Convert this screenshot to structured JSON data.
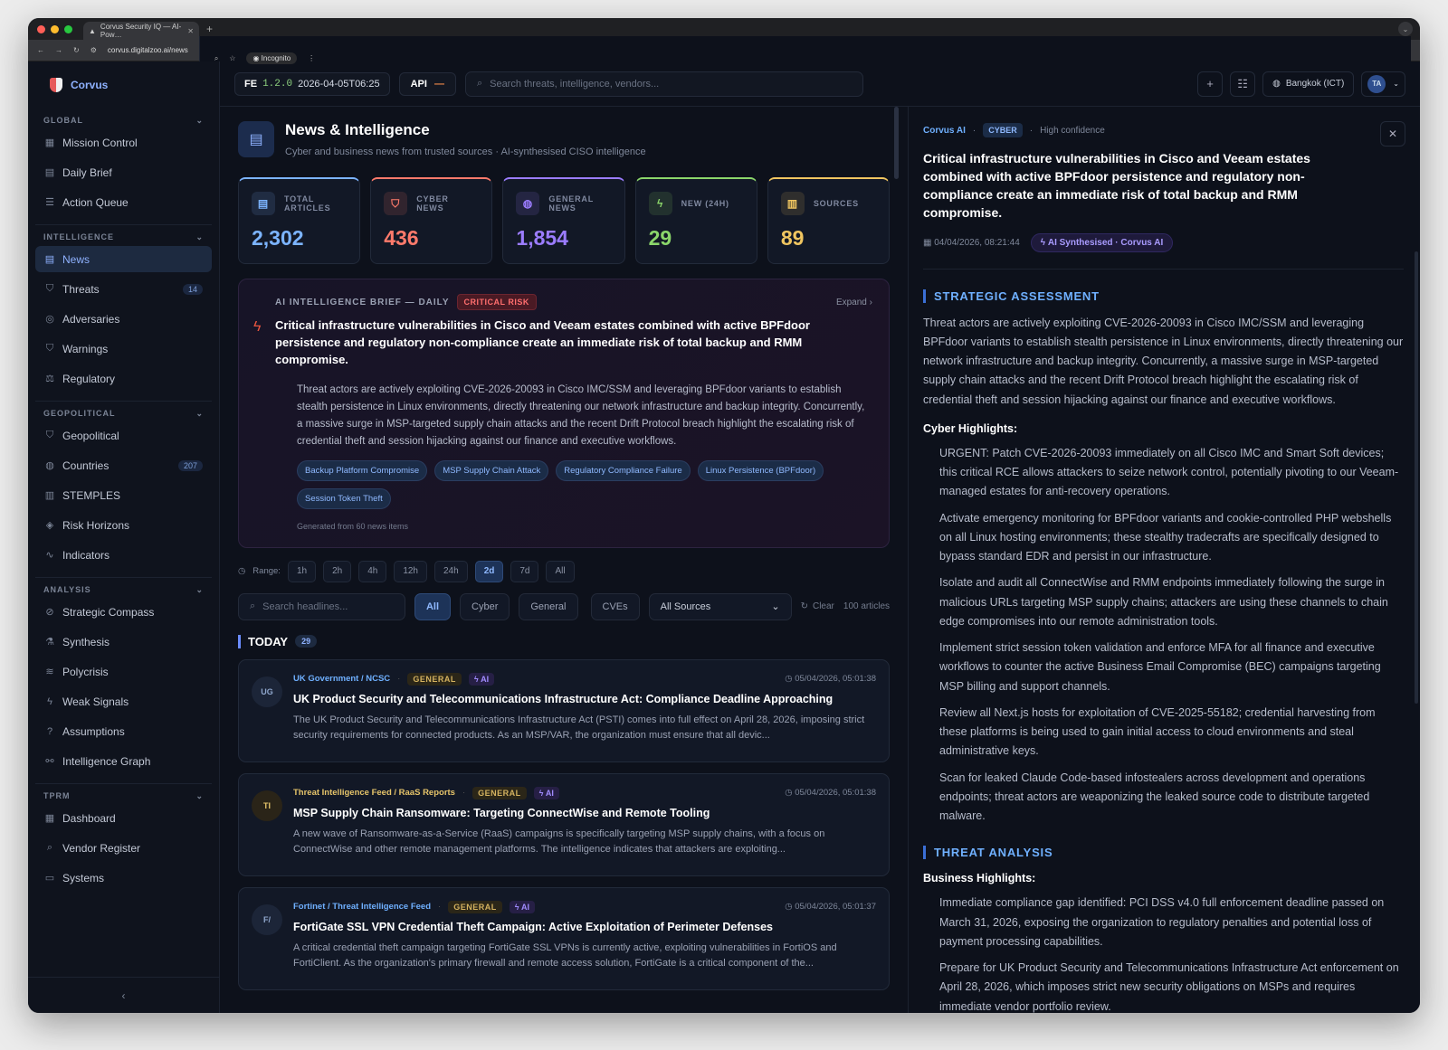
{
  "browser": {
    "tab_title": "Corvus Security IQ — AI-Pow…",
    "url": "corvus.digitalzoo.ai/news",
    "incognito": "Incognito"
  },
  "app": {
    "name": "Corvus"
  },
  "sidebar": {
    "sections": [
      {
        "title": "GLOBAL",
        "items": [
          {
            "label": "Mission Control",
            "icon": "grid-icon"
          },
          {
            "label": "Daily Brief",
            "icon": "document-icon"
          },
          {
            "label": "Action Queue",
            "icon": "list-icon"
          }
        ]
      },
      {
        "title": "INTELLIGENCE",
        "items": [
          {
            "label": "News",
            "icon": "news-icon",
            "active": true
          },
          {
            "label": "Threats",
            "icon": "shield-icon",
            "count": "14"
          },
          {
            "label": "Adversaries",
            "icon": "target-icon"
          },
          {
            "label": "Warnings",
            "icon": "shield-icon"
          },
          {
            "label": "Regulatory",
            "icon": "scale-icon"
          }
        ]
      },
      {
        "title": "GEOPOLITICAL",
        "items": [
          {
            "label": "Geopolitical",
            "icon": "shield-icon"
          },
          {
            "label": "Countries",
            "icon": "globe-icon",
            "count": "207"
          },
          {
            "label": "STEMPLES",
            "icon": "bar-chart-icon"
          },
          {
            "label": "Risk Horizons",
            "icon": "layers-icon"
          },
          {
            "label": "Indicators",
            "icon": "activity-icon"
          }
        ]
      },
      {
        "title": "ANALYSIS",
        "items": [
          {
            "label": "Strategic Compass",
            "icon": "compass-icon"
          },
          {
            "label": "Synthesis",
            "icon": "flask-icon"
          },
          {
            "label": "Polycrisis",
            "icon": "waves-icon"
          },
          {
            "label": "Weak Signals",
            "icon": "bolt-icon"
          },
          {
            "label": "Assumptions",
            "icon": "help-icon"
          },
          {
            "label": "Intelligence Graph",
            "icon": "graph-icon"
          }
        ]
      },
      {
        "title": "TPRM",
        "items": [
          {
            "label": "Dashboard",
            "icon": "grid-icon"
          },
          {
            "label": "Vendor Register",
            "icon": "search-icon"
          },
          {
            "label": "Systems",
            "icon": "monitor-icon"
          }
        ]
      }
    ]
  },
  "topbar": {
    "fe": "FE",
    "version": "1.2.0",
    "build_time": "2026-04-05T06:25",
    "api": "API",
    "api_status": "—",
    "search_placeholder": "Search threats, intelligence, vendors...",
    "timezone": "Bangkok (ICT)",
    "user_initials": "TA"
  },
  "page": {
    "title": "News & Intelligence",
    "subtitle": "Cyber and business news from trusted sources · AI-synthesised CISO intelligence"
  },
  "stats": [
    {
      "label": "TOTAL ARTICLES",
      "value": "2,302",
      "color": "#7cb4ff",
      "icon": "news-icon"
    },
    {
      "label": "CYBER NEWS",
      "value": "436",
      "color": "#ff7a6b",
      "icon": "shield-icon"
    },
    {
      "label": "GENERAL NEWS",
      "value": "1,854",
      "color": "#9b7cff",
      "icon": "globe-icon"
    },
    {
      "label": "NEW (24H)",
      "value": "29",
      "color": "#8bd66a",
      "icon": "bolt-icon"
    },
    {
      "label": "SOURCES",
      "value": "89",
      "color": "#f0c560",
      "icon": "bar-chart-icon"
    }
  ],
  "brief": {
    "label": "AI INTELLIGENCE BRIEF — DAILY",
    "risk": "CRITICAL RISK",
    "expand": "Expand",
    "title": "Critical infrastructure vulnerabilities in Cisco and Veeam estates combined with active BPFdoor persistence and regulatory non-compliance create an immediate risk of total backup and RMM compromise.",
    "text": "Threat actors are actively exploiting CVE-2026-20093 in Cisco IMC/SSM and leveraging BPFdoor variants to establish stealth persistence in Linux environments, directly threatening our network infrastructure and backup integrity. Concurrently, a massive surge in MSP-targeted supply chain attacks and the recent Drift Protocol breach highlight the escalating risk of credential theft and session hijacking against our finance and executive workflows.",
    "tags": [
      "Backup Platform Compromise",
      "MSP Supply Chain Attack",
      "Regulatory Compliance Failure",
      "Linux Persistence (BPFdoor)",
      "Session Token Theft"
    ],
    "generated": "Generated from 60 news items"
  },
  "range": {
    "label": "Range:",
    "options": [
      "1h",
      "2h",
      "4h",
      "12h",
      "24h",
      "2d",
      "7d",
      "All"
    ],
    "selected": "2d"
  },
  "filters": {
    "search_placeholder": "Search headlines...",
    "types": [
      "All",
      "Cyber",
      "General",
      "CVEs"
    ],
    "selected": "All",
    "source": "All Sources",
    "clear": "Clear",
    "count": "100 articles"
  },
  "today": {
    "label": "TODAY",
    "count": "29"
  },
  "articles": [
    {
      "abbr": "UG",
      "source": "UK Government / NCSC",
      "category": "GENERAL",
      "ai": "AI",
      "time": "05/04/2026, 05:01:38",
      "title": "UK Product Security and Telecommunications Infrastructure Act: Compliance Deadline Approaching",
      "summary": "The UK Product Security and Telecommunications Infrastructure Act (PSTI) comes into full effect on April 28, 2026, imposing strict security requirements for connected products. As an MSP/VAR, the organization must ensure that all devic..."
    },
    {
      "abbr": "TI",
      "source": "Threat Intelligence Feed / RaaS Reports",
      "category": "GENERAL",
      "ai": "AI",
      "time": "05/04/2026, 05:01:38",
      "title": "MSP Supply Chain Ransomware: Targeting ConnectWise and Remote Tooling",
      "summary": "A new wave of Ransomware-as-a-Service (RaaS) campaigns is specifically targeting MSP supply chains, with a focus on ConnectWise and other remote management platforms. The intelligence indicates that attackers are exploiting..."
    },
    {
      "abbr": "F/",
      "source": "Fortinet / Threat Intelligence Feed",
      "category": "GENERAL",
      "ai": "AI",
      "time": "05/04/2026, 05:01:37",
      "title": "FortiGate SSL VPN Credential Theft Campaign: Active Exploitation of Perimeter Defenses",
      "summary": "A critical credential theft campaign targeting FortiGate SSL VPNs is currently active, exploiting vulnerabilities in FortiOS and FortiClient. As the organization's primary firewall and remote access solution, FortiGate is a critical component of the..."
    }
  ],
  "detail": {
    "source": "Corvus AI",
    "category": "CYBER",
    "confidence": "High confidence",
    "title": "Critical infrastructure vulnerabilities in Cisco and Veeam estates combined with active BPFdoor persistence and regulatory non-compliance create an immediate risk of total backup and RMM compromise.",
    "date": "04/04/2026, 08:21:44",
    "badge": "AI Synthesised · Corvus AI",
    "strategic_heading": "STRATEGIC ASSESSMENT",
    "strategic_text": "Threat actors are actively exploiting CVE-2026-20093 in Cisco IMC/SSM and leveraging BPFdoor variants to establish stealth persistence in Linux environments, directly threatening our network infrastructure and backup integrity. Concurrently, a massive surge in MSP-targeted supply chain attacks and the recent Drift Protocol breach highlight the escalating risk of credential theft and session hijacking against our finance and executive workflows.",
    "cyber_heading": "Cyber Highlights:",
    "cyber_items": [
      "URGENT: Patch CVE-2026-20093 immediately on all Cisco IMC and Smart Soft devices; this critical RCE allows attackers to seize network control, potentially pivoting to our Veeam-managed estates for anti-recovery operations.",
      "Activate emergency monitoring for BPFdoor variants and cookie-controlled PHP webshells on all Linux hosting environments; these stealthy tradecrafts are specifically designed to bypass standard EDR and persist in our infrastructure.",
      "Isolate and audit all ConnectWise and RMM endpoints immediately following the surge in malicious URLs targeting MSP supply chains; attackers are using these channels to chain edge compromises into our remote administration tools.",
      "Implement strict session token validation and enforce MFA for all finance and executive workflows to counter the active Business Email Compromise (BEC) campaigns targeting MSP billing and support channels.",
      "Review all Next.js hosts for exploitation of CVE-2025-55182; credential harvesting from these platforms is being used to gain initial access to cloud environments and steal administrative keys.",
      "Scan for leaked Claude Code-based infostealers across development and operations endpoints; threat actors are weaponizing the leaked source code to distribute targeted malware."
    ],
    "threat_heading": "THREAT ANALYSIS",
    "business_heading": "Business Highlights:",
    "business_items": [
      "Immediate compliance gap identified: PCI DSS v4.0 full enforcement deadline passed on March 31, 2026, exposing the organization to regulatory penalties and potential loss of payment processing capabilities.",
      "Prepare for UK Product Security and Telecommunications Infrastructure Act enforcement on April 28, 2026, which imposes strict new security obligations on MSPs and requires immediate vendor portfolio review."
    ]
  }
}
